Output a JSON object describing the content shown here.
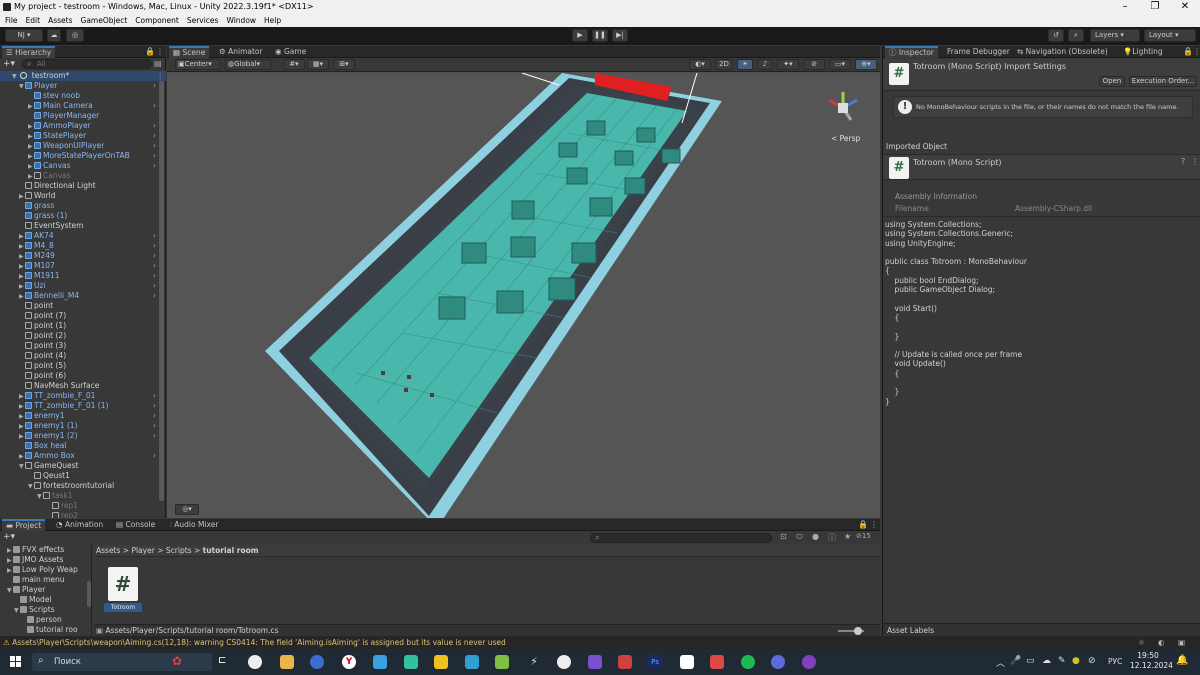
{
  "window": {
    "title": "My project - testroom - Windows, Mac, Linux - Unity 2022.3.19f1* <DX11>"
  },
  "menu": [
    "File",
    "Edit",
    "Assets",
    "GameObject",
    "Component",
    "Services",
    "Window",
    "Help"
  ],
  "toolbar": {
    "account": "NJ",
    "layers": "Layers",
    "layout": "Layout"
  },
  "hierarchy": {
    "tab": "Hierarchy",
    "search_placeholder": "All",
    "scene": "testroom*",
    "rows": [
      {
        "label": "Player",
        "indent": 1,
        "style": "blue",
        "arrow": "▼"
      },
      {
        "label": "stev noob",
        "indent": 2,
        "style": "blue",
        "arrow": ""
      },
      {
        "label": "Main Camera",
        "indent": 2,
        "style": "blue",
        "arrow": "▶"
      },
      {
        "label": "PlayerManager",
        "indent": 2,
        "style": "blue",
        "arrow": ""
      },
      {
        "label": "AmmoPlayer",
        "indent": 2,
        "style": "blue",
        "arrow": "▶"
      },
      {
        "label": "StatePlayer",
        "indent": 2,
        "style": "blue",
        "arrow": "▶"
      },
      {
        "label": "WeaponUIPlayer",
        "indent": 2,
        "style": "blue",
        "arrow": "▶"
      },
      {
        "label": "MoreStatePlayerOnTAB",
        "indent": 2,
        "style": "blue",
        "arrow": "▶"
      },
      {
        "label": "Canvas",
        "indent": 2,
        "style": "blue",
        "arrow": "▶"
      },
      {
        "label": "Canvas",
        "indent": 2,
        "style": "dim",
        "arrow": "▶"
      },
      {
        "label": "Directional Light",
        "indent": 1,
        "style": "",
        "arrow": ""
      },
      {
        "label": "World",
        "indent": 1,
        "style": "",
        "arrow": "▶"
      },
      {
        "label": "grass",
        "indent": 1,
        "style": "blue",
        "arrow": ""
      },
      {
        "label": "grass (1)",
        "indent": 1,
        "style": "blue",
        "arrow": ""
      },
      {
        "label": "EventSystem",
        "indent": 1,
        "style": "",
        "arrow": ""
      },
      {
        "label": "AK74",
        "indent": 1,
        "style": "blue",
        "arrow": "▶"
      },
      {
        "label": "M4_8",
        "indent": 1,
        "style": "blue",
        "arrow": "▶"
      },
      {
        "label": "M249",
        "indent": 1,
        "style": "blue",
        "arrow": "▶"
      },
      {
        "label": "M107",
        "indent": 1,
        "style": "blue",
        "arrow": "▶"
      },
      {
        "label": "M1911",
        "indent": 1,
        "style": "blue",
        "arrow": "▶"
      },
      {
        "label": "Uzi",
        "indent": 1,
        "style": "blue",
        "arrow": "▶"
      },
      {
        "label": "Bennelli_M4",
        "indent": 1,
        "style": "blue",
        "arrow": "▶"
      },
      {
        "label": "point",
        "indent": 1,
        "style": "",
        "arrow": ""
      },
      {
        "label": "point (7)",
        "indent": 1,
        "style": "",
        "arrow": ""
      },
      {
        "label": "point (1)",
        "indent": 1,
        "style": "",
        "arrow": ""
      },
      {
        "label": "point (2)",
        "indent": 1,
        "style": "",
        "arrow": ""
      },
      {
        "label": "point (3)",
        "indent": 1,
        "style": "",
        "arrow": ""
      },
      {
        "label": "point (4)",
        "indent": 1,
        "style": "",
        "arrow": ""
      },
      {
        "label": "point (5)",
        "indent": 1,
        "style": "",
        "arrow": ""
      },
      {
        "label": "point (6)",
        "indent": 1,
        "style": "",
        "arrow": ""
      },
      {
        "label": "NavMesh Surface",
        "indent": 1,
        "style": "",
        "arrow": ""
      },
      {
        "label": "TT_zombie_F_01",
        "indent": 1,
        "style": "blue",
        "arrow": "▶"
      },
      {
        "label": "TT_zombie_F_01 (1)",
        "indent": 1,
        "style": "blue",
        "arrow": "▶"
      },
      {
        "label": "enemy1",
        "indent": 1,
        "style": "blue",
        "arrow": "▶"
      },
      {
        "label": "enemy1 (1)",
        "indent": 1,
        "style": "blue",
        "arrow": "▶"
      },
      {
        "label": "enemy1 (2)",
        "indent": 1,
        "style": "blue",
        "arrow": "▶"
      },
      {
        "label": "Box heal",
        "indent": 1,
        "style": "blue",
        "arrow": ""
      },
      {
        "label": "Ammo Box",
        "indent": 1,
        "style": "blue",
        "arrow": "▶"
      },
      {
        "label": "GameQuest",
        "indent": 1,
        "style": "",
        "arrow": "▼"
      },
      {
        "label": "Qeust1",
        "indent": 2,
        "style": "",
        "arrow": ""
      },
      {
        "label": "fortestroomtutorial",
        "indent": 2,
        "style": "",
        "arrow": "▼"
      },
      {
        "label": "task1",
        "indent": 3,
        "style": "dim",
        "arrow": "▼"
      },
      {
        "label": "rep1",
        "indent": 4,
        "style": "dim",
        "arrow": ""
      },
      {
        "label": "rep2",
        "indent": 4,
        "style": "dim",
        "arrow": ""
      }
    ]
  },
  "scene": {
    "tabs": [
      "Scene",
      "Animator",
      "Game"
    ],
    "pivot": "Center",
    "space": "Global",
    "mode_2d": "2D",
    "persp": "< Persp"
  },
  "inspector": {
    "tabs": [
      "Inspector",
      "Frame Debugger",
      "Navigation (Obsolete)",
      "Lighting"
    ],
    "title": "Totroom (Mono Script) Import Settings",
    "open_label": "Open",
    "exec_order_label": "Execution Order...",
    "warning": "No MonoBehaviour scripts in the file, or their names do not match the file name.",
    "imported_object": "Imported Object",
    "object_title": "Totroom (Mono Script)",
    "assembly_info": "Assembly Information",
    "filename_label": "Filename",
    "filename_value": "Assembly-CSharp.dll",
    "code": "using System.Collections;\nusing System.Collections.Generic;\nusing UnityEngine;\n\npublic class Totroom : MonoBehaviour\n{\n    public bool EndDialog;\n    public GameObject Dialog;\n\n    void Start()\n    {\n\n    }\n\n    // Update is called once per frame\n    void Update()\n    {\n\n    }\n}",
    "asset_labels": "Asset Labels"
  },
  "project": {
    "tabs": [
      "Project",
      "Animation",
      "Console",
      "Audio Mixer"
    ],
    "tree": [
      {
        "label": "FVX effects",
        "indent": 1,
        "arrow": "▶"
      },
      {
        "label": "JMO Assets",
        "indent": 1,
        "arrow": "▶"
      },
      {
        "label": "Low Poly Weap",
        "indent": 1,
        "arrow": "▶"
      },
      {
        "label": "main menu",
        "indent": 1,
        "arrow": ""
      },
      {
        "label": "Player",
        "indent": 1,
        "arrow": "▼"
      },
      {
        "label": "Model",
        "indent": 2,
        "arrow": ""
      },
      {
        "label": "Scripts",
        "indent": 2,
        "arrow": "▼"
      },
      {
        "label": "person",
        "indent": 3,
        "arrow": ""
      },
      {
        "label": "tutorial roo",
        "indent": 3,
        "arrow": ""
      }
    ],
    "breadcrumb": [
      "Assets",
      "Player",
      "Scripts",
      "tutorial room"
    ],
    "asset_name": "Totroom",
    "footer_path": "Assets/Player/Scripts/tutorial room/Totroom.cs",
    "count_badge": "15"
  },
  "status": {
    "message": "Assets\\Player\\Scripts\\weapon\\Aiming.cs(12,18): warning CS0414: The field 'Aiming.isAiming' is assigned but its value is never used"
  },
  "taskbar": {
    "search": "Поиск",
    "lang": "РУС",
    "time": "19:50",
    "date": "12.12.2024"
  }
}
